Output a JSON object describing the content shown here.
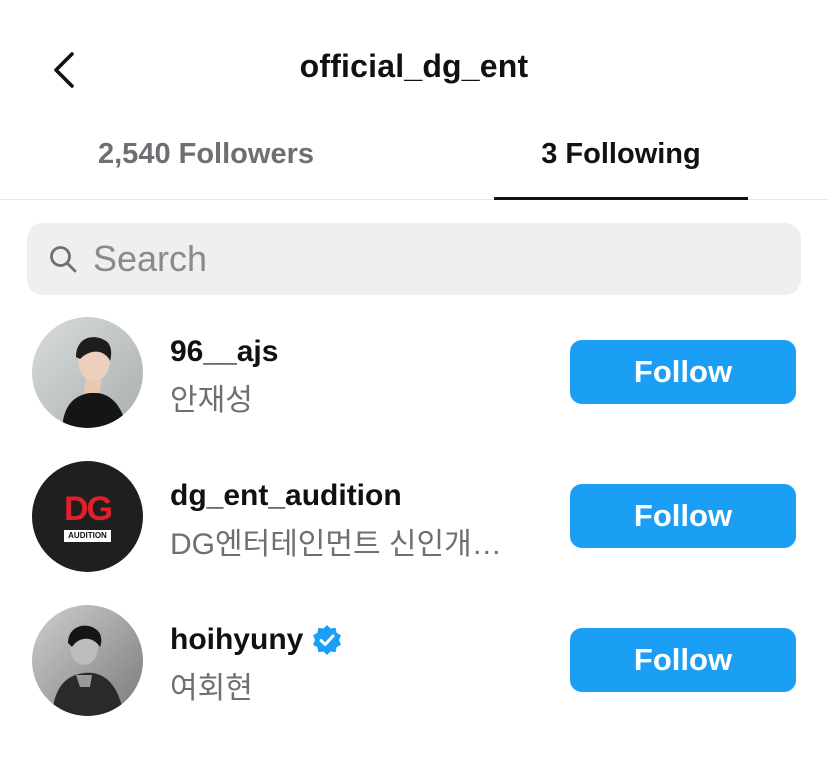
{
  "header": {
    "title": "official_dg_ent",
    "back_icon": "chevron-left-icon"
  },
  "tabs": [
    {
      "label": "2,540 Followers",
      "active": false
    },
    {
      "label": "3 Following",
      "active": true
    }
  ],
  "search": {
    "placeholder": "Search",
    "value": "",
    "icon": "search-icon"
  },
  "colors": {
    "accent": "#1a9ff5",
    "verified": "#1a9ff5",
    "muted_text": "#6e6e73",
    "search_bg": "#efeff0",
    "dg_logo_red": "#e0202a"
  },
  "users": [
    {
      "username": "96__ajs",
      "fullname": "안재성",
      "verified": false,
      "button": "Follow"
    },
    {
      "username": "dg_ent_audition",
      "fullname": "DG엔터테인먼트 신인개…",
      "verified": false,
      "button": "Follow",
      "avatar_logo": "DG",
      "avatar_logo_sub": "AUDITION"
    },
    {
      "username": "hoihyuny",
      "fullname": "여회현",
      "verified": true,
      "button": "Follow"
    }
  ]
}
